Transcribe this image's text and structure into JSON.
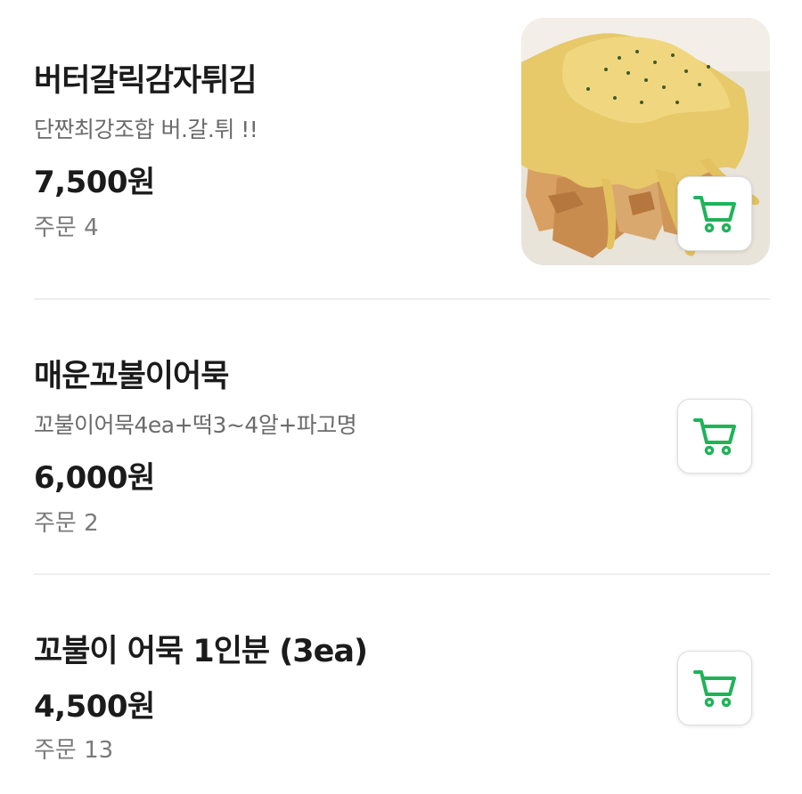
{
  "menu": {
    "items": [
      {
        "name": "버터갈릭감자튀김",
        "description": "단짠최강조합 버.갈.튀 !!",
        "price": "7,500원",
        "orders": "주문 4",
        "has_photo": true
      },
      {
        "name": "매운꼬불이어묵",
        "description": "꼬불이어묵4ea+떡3~4알+파고명",
        "price": "6,000원",
        "orders": "주문 2",
        "has_photo": false
      },
      {
        "name": "꼬불이 어묵 1인분 (3ea)",
        "price": "4,500원",
        "orders": "주문 13",
        "has_photo": false
      }
    ]
  },
  "icons": {
    "cart": "cart-icon"
  },
  "colors": {
    "accent": "#1fb35a",
    "divider": "#eeeeee",
    "text_primary": "#1b1b1b",
    "text_secondary": "#6b6b6b"
  }
}
